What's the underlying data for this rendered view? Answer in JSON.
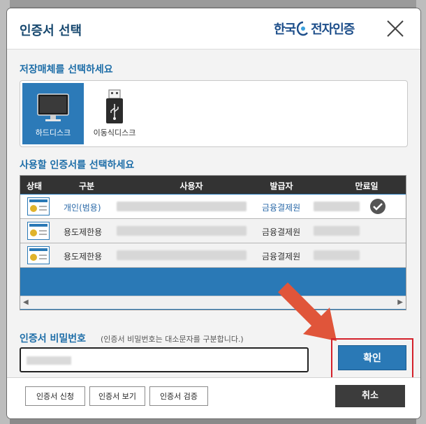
{
  "dialog": {
    "title": "인증서 선택",
    "logo_text_1": "한국",
    "logo_text_2": "전자인증"
  },
  "storage": {
    "section_title": "저장매체를 선택하세요",
    "items": [
      {
        "label": "하드디스크",
        "icon": "monitor-icon",
        "selected": true
      },
      {
        "label": "이동식디스크",
        "icon": "usb-icon",
        "selected": false
      }
    ]
  },
  "certs": {
    "section_title": "사용할 인증서를 선택하세요",
    "columns": [
      "상태",
      "구분",
      "사용자",
      "발급자",
      "만료일"
    ],
    "rows": [
      {
        "type": "개인(범용)",
        "issuer": "금융결제원",
        "selected": true
      },
      {
        "type": "용도제한용",
        "issuer": "금융결제원",
        "selected": false
      },
      {
        "type": "용도제한용",
        "issuer": "금융결제원",
        "selected": false
      }
    ]
  },
  "password": {
    "label": "인증서 비밀번호",
    "hint": "(인증서 비밀번호는 대소문자를 구분합니다.)"
  },
  "buttons": {
    "confirm": "확인",
    "cancel": "취소",
    "footer": [
      "인증서 신청",
      "인증서 보기",
      "인증서 검증"
    ]
  },
  "colors": {
    "accent": "#2a79b6",
    "highlight": "#d4202a",
    "arrow": "#e0553a"
  }
}
